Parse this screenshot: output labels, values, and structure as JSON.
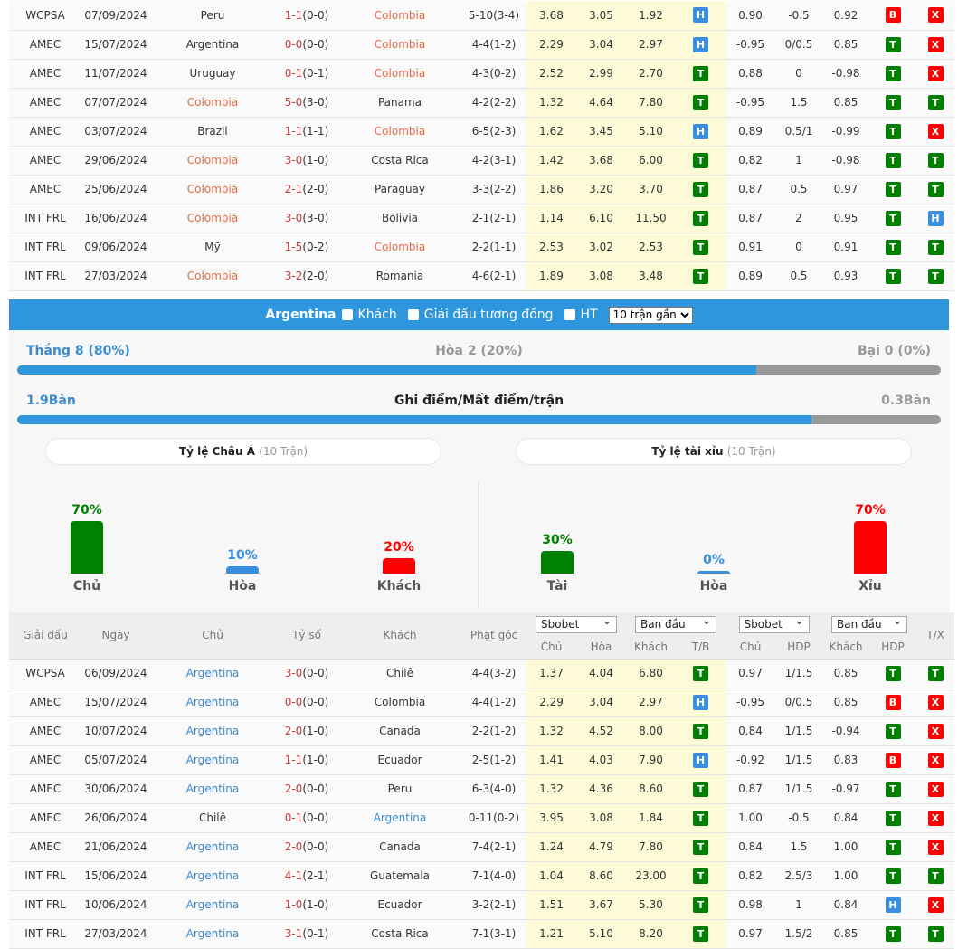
{
  "colors": {
    "win": "#008000",
    "draw": "#3a8ee0",
    "loss": "#ff0000",
    "accent": "#2d96dc",
    "highlight_top": "#e06a4c",
    "highlight_bottom": "#3d8ad0"
  },
  "top_table": {
    "highlight_team": "Colombia",
    "rows": [
      [
        "WCPSA",
        "07/09/2024",
        "Peru",
        "1-1",
        "(0-0)",
        "Colombia",
        "5-10(3-4)",
        "3.68",
        "3.05",
        "1.92",
        "H",
        "0.90",
        "-0.5",
        "0.92",
        "B",
        "X"
      ],
      [
        "AMEC",
        "15/07/2024",
        "Argentina",
        "0-0",
        "(0-0)",
        "Colombia",
        "4-4(1-2)",
        "2.29",
        "3.04",
        "2.97",
        "H",
        "-0.95",
        "0/0.5",
        "0.85",
        "T",
        "X"
      ],
      [
        "AMEC",
        "11/07/2024",
        "Uruguay",
        "0-1",
        "(0-1)",
        "Colombia",
        "4-3(0-2)",
        "2.52",
        "2.99",
        "2.70",
        "T",
        "0.88",
        "0",
        "-0.98",
        "T",
        "X"
      ],
      [
        "AMEC",
        "07/07/2024",
        "Colombia",
        "5-0",
        "(3-0)",
        "Panama",
        "4-2(2-2)",
        "1.32",
        "4.64",
        "7.80",
        "T",
        "-0.95",
        "1.5",
        "0.85",
        "T",
        "T"
      ],
      [
        "AMEC",
        "03/07/2024",
        "Brazil",
        "1-1",
        "(1-1)",
        "Colombia",
        "6-5(2-3)",
        "1.62",
        "3.45",
        "5.10",
        "H",
        "0.89",
        "0.5/1",
        "-0.99",
        "T",
        "X"
      ],
      [
        "AMEC",
        "29/06/2024",
        "Colombia",
        "3-0",
        "(1-0)",
        "Costa Rica",
        "4-2(3-1)",
        "1.42",
        "3.68",
        "6.00",
        "T",
        "0.82",
        "1",
        "-0.98",
        "T",
        "T"
      ],
      [
        "AMEC",
        "25/06/2024",
        "Colombia",
        "2-1",
        "(2-0)",
        "Paraguay",
        "3-3(2-2)",
        "1.86",
        "3.20",
        "3.70",
        "T",
        "0.87",
        "0.5",
        "0.97",
        "T",
        "T"
      ],
      [
        "INT FRL",
        "16/06/2024",
        "Colombia",
        "3-0",
        "(3-0)",
        "Bolivia",
        "2-1(2-1)",
        "1.14",
        "6.10",
        "11.50",
        "T",
        "0.87",
        "2",
        "0.95",
        "T",
        "H"
      ],
      [
        "INT FRL",
        "09/06/2024",
        "Mỹ",
        "1-5",
        "(0-2)",
        "Colombia",
        "2-2(1-1)",
        "2.53",
        "3.02",
        "2.53",
        "T",
        "0.91",
        "0",
        "0.91",
        "T",
        "T"
      ],
      [
        "INT FRL",
        "27/03/2024",
        "Colombia",
        "3-2",
        "(2-0)",
        "Romania",
        "4-6(2-1)",
        "1.89",
        "3.08",
        "3.48",
        "T",
        "0.89",
        "0.5",
        "0.93",
        "T",
        "T"
      ]
    ]
  },
  "filter_bar": {
    "team": "Argentina",
    "opt_away": "Khách",
    "opt_same_league": "Giải đấu tương đồng",
    "opt_ht": "HT",
    "recent_select": "10 trận gần"
  },
  "summary": {
    "win_label": "Thắng 8 (80%)",
    "draw_label": "Hòa 2 (20%)",
    "loss_label": "Bại 0 (0%)",
    "win_pct": 80,
    "goals_for": "1.9Bàn",
    "goals_title": "Ghi điểm/Mất điểm/trận",
    "goals_against": "0.3Bàn",
    "goals_for_share": 86,
    "asian_title": "Tỷ lệ Châu Á",
    "asian_count": "(10 Trận)",
    "ou_title": "Tỷ lệ tài xỉu",
    "ou_count": "(10 Trận)",
    "asian_bars": [
      {
        "pct": "70%",
        "value": 70,
        "name": "Chủ",
        "color": "#008000"
      },
      {
        "pct": "10%",
        "value": 10,
        "name": "Hòa",
        "color": "#3a8ee0"
      },
      {
        "pct": "20%",
        "value": 20,
        "name": "Khách",
        "color": "#ff0000"
      }
    ],
    "ou_bars": [
      {
        "pct": "30%",
        "value": 30,
        "name": "Tài",
        "color": "#008000"
      },
      {
        "pct": "0%",
        "value": 0,
        "name": "Hòa",
        "color": "#3a8ee0"
      },
      {
        "pct": "70%",
        "value": 70,
        "name": "Xỉu",
        "color": "#ff0000"
      }
    ]
  },
  "bottom_table": {
    "highlight_team": "Argentina",
    "headers": {
      "league": "Giải đấu",
      "date": "Ngày",
      "home": "Chủ",
      "score": "Tỷ số",
      "away": "Khách",
      "corner": "Phạt góc",
      "bookmaker1": "Sbobet",
      "type1": "Ban đầu",
      "bookmaker2": "Sbobet",
      "type2": "Ban đầu",
      "tx": "T/X",
      "sub": [
        "Chủ",
        "Hòa",
        "Khách",
        "T/B",
        "Chủ",
        "HDP",
        "Khách",
        "HDP"
      ]
    },
    "rows": [
      [
        "WCPSA",
        "06/09/2024",
        "Argentina",
        "3-0",
        "(0-0)",
        "Chilê",
        "4-4(3-2)",
        "1.37",
        "4.04",
        "6.80",
        "T",
        "0.97",
        "1/1.5",
        "0.85",
        "T",
        "T"
      ],
      [
        "AMEC",
        "15/07/2024",
        "Argentina",
        "0-0",
        "(0-0)",
        "Colombia",
        "4-4(1-2)",
        "2.29",
        "3.04",
        "2.97",
        "H",
        "-0.95",
        "0/0.5",
        "0.85",
        "B",
        "X"
      ],
      [
        "AMEC",
        "10/07/2024",
        "Argentina",
        "2-0",
        "(1-0)",
        "Canada",
        "2-2(1-2)",
        "1.32",
        "4.52",
        "8.00",
        "T",
        "0.84",
        "1/1.5",
        "-0.94",
        "T",
        "X"
      ],
      [
        "AMEC",
        "05/07/2024",
        "Argentina",
        "1-1",
        "(1-0)",
        "Ecuador",
        "2-5(1-2)",
        "1.41",
        "4.03",
        "7.90",
        "H",
        "-0.92",
        "1/1.5",
        "0.83",
        "B",
        "X"
      ],
      [
        "AMEC",
        "30/06/2024",
        "Argentina",
        "2-0",
        "(0-0)",
        "Peru",
        "6-3(4-0)",
        "1.32",
        "4.36",
        "8.60",
        "T",
        "0.87",
        "1/1.5",
        "-0.97",
        "T",
        "X"
      ],
      [
        "AMEC",
        "26/06/2024",
        "Chilê",
        "0-1",
        "(0-0)",
        "Argentina",
        "0-11(0-2)",
        "3.95",
        "3.08",
        "1.84",
        "T",
        "1.00",
        "-0.5",
        "0.84",
        "T",
        "X"
      ],
      [
        "AMEC",
        "21/06/2024",
        "Argentina",
        "2-0",
        "(0-0)",
        "Canada",
        "7-4(2-1)",
        "1.24",
        "4.79",
        "7.80",
        "T",
        "0.84",
        "1.5",
        "1.00",
        "T",
        "X"
      ],
      [
        "INT FRL",
        "15/06/2024",
        "Argentina",
        "4-1",
        "(2-1)",
        "Guatemala",
        "7-1(4-0)",
        "1.04",
        "8.60",
        "23.00",
        "T",
        "0.82",
        "2.5/3",
        "1.00",
        "T",
        "T"
      ],
      [
        "INT FRL",
        "10/06/2024",
        "Argentina",
        "1-0",
        "(1-0)",
        "Ecuador",
        "3-2(2-1)",
        "1.51",
        "3.67",
        "5.30",
        "T",
        "0.98",
        "1",
        "0.84",
        "H",
        "X"
      ],
      [
        "INT FRL",
        "27/03/2024",
        "Argentina",
        "3-1",
        "(0-1)",
        "Costa Rica",
        "7-1(3-1)",
        "1.21",
        "5.10",
        "8.20",
        "T",
        "0.97",
        "1.5/2",
        "0.85",
        "T",
        "T"
      ]
    ]
  }
}
